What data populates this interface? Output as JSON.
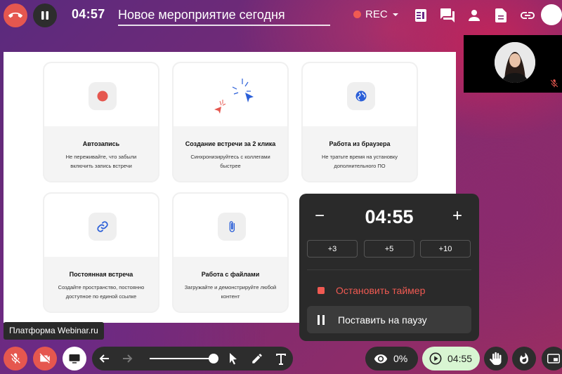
{
  "topbar": {
    "timer": "04:57",
    "title": "Новое мероприятие сегодня",
    "rec_label": "REC"
  },
  "cards": [
    {
      "title": "Автозапись",
      "desc": "Не переживайте, что забыли включить запись встречи",
      "icon": "record-icon"
    },
    {
      "title": "Создание встречи за 2 клика",
      "desc": "Синхронизируйтесь с коллегами быстрее",
      "icon": "cursor-click-icon"
    },
    {
      "title": "Работа из браузера",
      "desc": "Не тратьте время на установку дополнительного ПО",
      "icon": "globe-icon"
    },
    {
      "title": "Постоянная встреча",
      "desc": "Создайте пространство, постоянно доступное по единой ссылке",
      "icon": "link-icon"
    },
    {
      "title": "Работа с файлами",
      "desc": "Загружайте и демонстрируйте любой контент",
      "icon": "paperclip-icon"
    }
  ],
  "timer_popup": {
    "minus": "−",
    "plus": "+",
    "time": "04:55",
    "add_buttons": [
      "+3",
      "+5",
      "+10"
    ],
    "stop_label": "Остановить таймер",
    "pause_label": "Поставить на паузу"
  },
  "platform_label": "Платформа Webinar.ru",
  "bottombar": {
    "viewers_percent": "0%",
    "timer": "04:55"
  },
  "colors": {
    "accent_red": "#e5574f",
    "timer_green": "#d8f5d2",
    "card_bg": "#f4f4f4"
  }
}
